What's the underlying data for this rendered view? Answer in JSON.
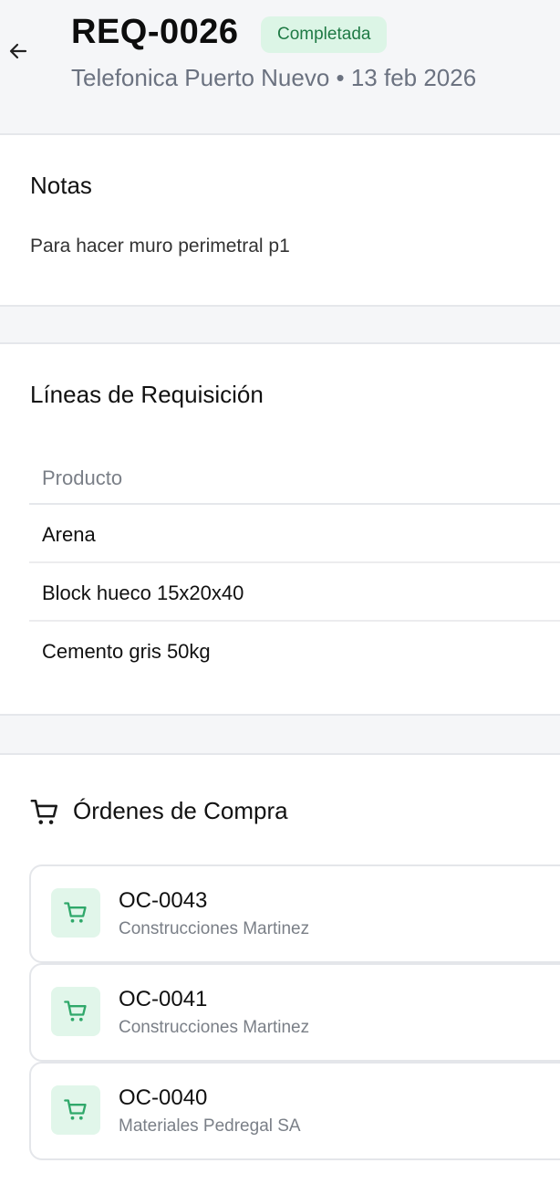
{
  "header": {
    "back_icon": "arrow-left-icon",
    "title": "REQ-0026",
    "status": "Completada",
    "subtitle": "Telefonica Puerto Nuevo • 13 feb 2026"
  },
  "notes": {
    "title": "Notas",
    "text": "Para hacer muro perimetral p1"
  },
  "lines": {
    "title": "Líneas de Requisición",
    "columns": [
      "Producto"
    ],
    "rows": [
      "Arena",
      "Block hueco 15x20x40",
      "Cemento gris 50kg"
    ]
  },
  "orders": {
    "title": "Órdenes de Compra",
    "icon": "shopping-cart-icon",
    "items": [
      {
        "number": "OC-0043",
        "supplier": "Construcciones Martinez"
      },
      {
        "number": "OC-0041",
        "supplier": "Construcciones Martinez"
      },
      {
        "number": "OC-0040",
        "supplier": "Materiales Pedregal SA"
      }
    ]
  },
  "colors": {
    "badge_bg": "#dcf5e6",
    "badge_text": "#1f7a45",
    "icon_accent": "#2fa86a"
  }
}
